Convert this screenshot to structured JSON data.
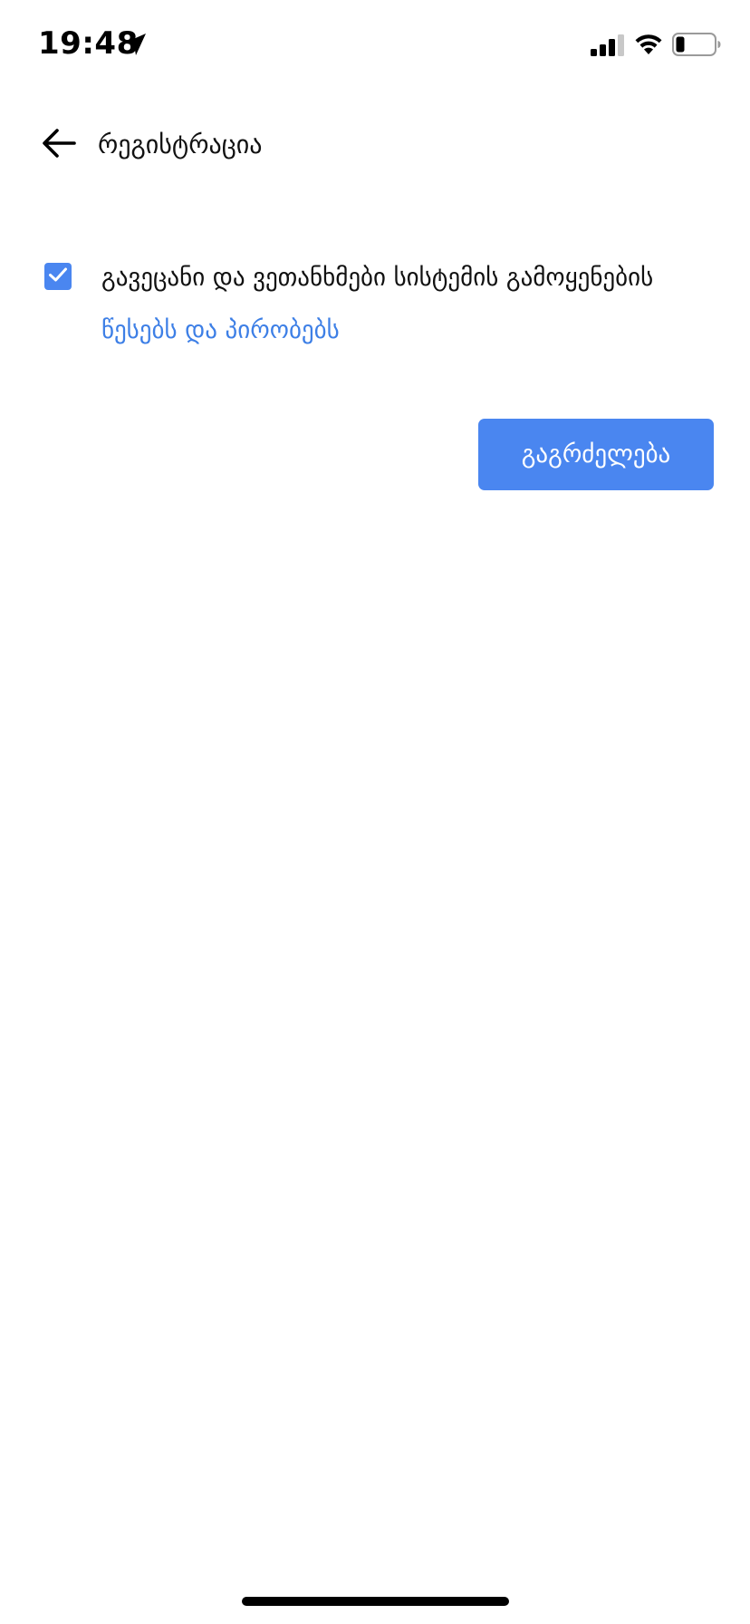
{
  "status_bar": {
    "time": "19:48",
    "icons": [
      "location-arrow-icon",
      "cellular-signal-icon",
      "wifi-icon",
      "battery-low-icon"
    ]
  },
  "header": {
    "back_icon": "arrow-left-icon",
    "title": "რეგისტრაცია"
  },
  "terms": {
    "checked": true,
    "text_prefix": "გავეცანი და ვეთანხმები სისტემის გამოყენების ",
    "link_label": "წესებს და პირობებს"
  },
  "actions": {
    "continue_label": "გაგრძელება"
  },
  "colors": {
    "accent": "#4a86f0",
    "link": "#3d7fe6",
    "text": "#111111",
    "background": "#ffffff"
  }
}
